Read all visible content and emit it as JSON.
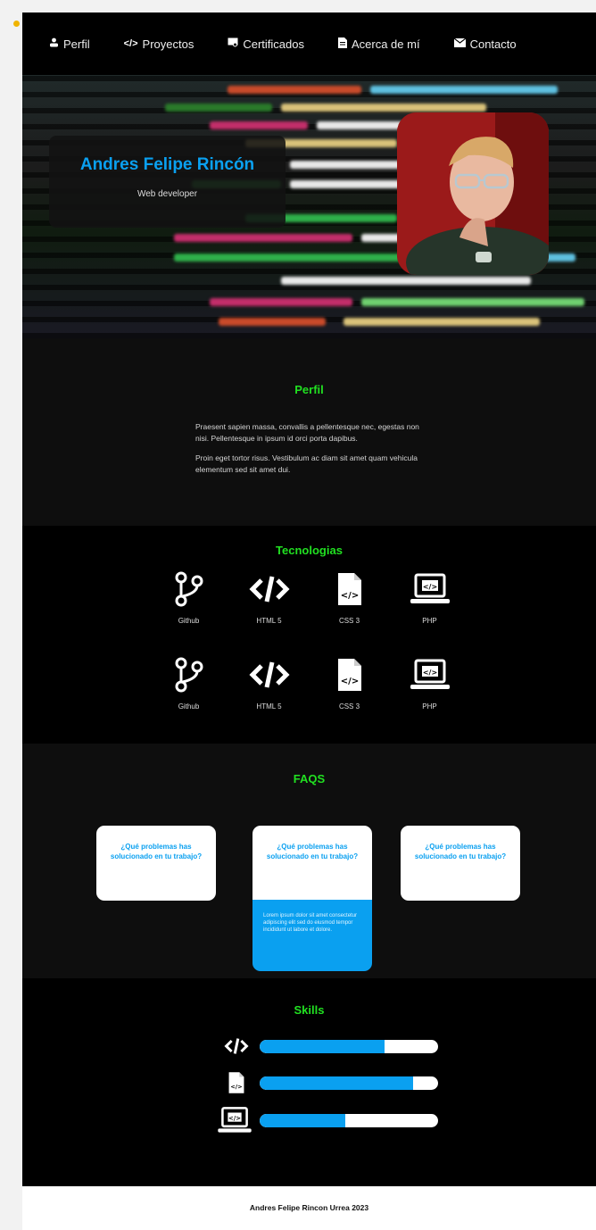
{
  "nav": {
    "items": [
      {
        "icon": "user-icon",
        "label": "Perfil"
      },
      {
        "icon": "code-icon",
        "label": "Proyectos"
      },
      {
        "icon": "certificate-icon",
        "label": "Certificados"
      },
      {
        "icon": "document-icon",
        "label": "Acerca de mí"
      },
      {
        "icon": "envelope-icon",
        "label": "Contacto"
      }
    ]
  },
  "hero": {
    "name": "Andres Felipe Rincón",
    "role": "Web developer"
  },
  "perfil": {
    "title": "Perfil",
    "paragraphs": [
      "Praesent sapien massa, convallis a pellentesque nec, egestas non nisi. Pellentesque in ipsum id orci porta dapibus.",
      "Proin eget tortor risus. Vestibulum ac diam sit amet quam vehicula elementum sed sit amet dui."
    ]
  },
  "tecnologias": {
    "title": "Tecnologias",
    "items": [
      {
        "icon": "git-branch-icon",
        "label": "Github"
      },
      {
        "icon": "code-icon",
        "label": "HTML 5"
      },
      {
        "icon": "code-file-icon",
        "label": "CSS 3"
      },
      {
        "icon": "laptop-code-icon",
        "label": "PHP"
      },
      {
        "icon": "git-branch-icon",
        "label": "Github"
      },
      {
        "icon": "code-icon",
        "label": "HTML 5"
      },
      {
        "icon": "code-file-icon",
        "label": "CSS 3"
      },
      {
        "icon": "laptop-code-icon",
        "label": "PHP"
      }
    ]
  },
  "faqs": {
    "title": "FAQS",
    "cards": [
      {
        "question": "¿Qué problemas has solucionado en tu trabajo?"
      },
      {
        "question": "¿Qué problemas has solucionado en tu trabajo?",
        "answer": "Lorem ipsum dolor sit amet consectetur adipiscing elit sed do eiusmod tempor incididunt ut labore et dolore."
      },
      {
        "question": "¿Qué problemas has solucionado en tu trabajo?"
      }
    ]
  },
  "skills": {
    "title": "Skills",
    "items": [
      {
        "icon": "code-icon",
        "level": 0.7
      },
      {
        "icon": "code-file-icon",
        "level": 0.86
      },
      {
        "icon": "laptop-code-icon",
        "level": 0.48
      }
    ]
  },
  "footer": {
    "text": "Andres Felipe Rincon Urrea 2023"
  },
  "colors": {
    "accent_blue": "#0aa0f0",
    "title_green": "#21e021"
  }
}
